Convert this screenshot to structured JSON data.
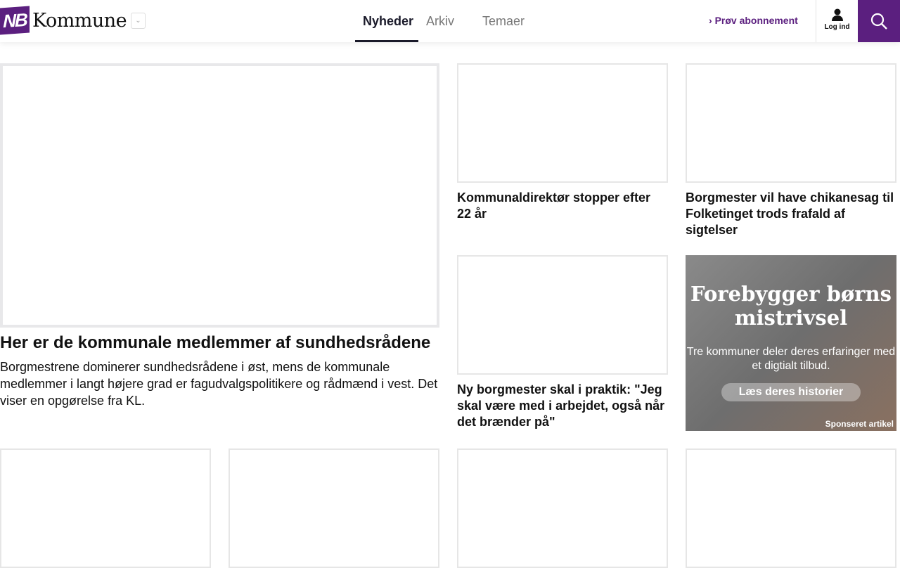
{
  "header": {
    "logo_mark": "NB",
    "logo_text": "Kommune",
    "nav": [
      "Nyheder",
      "Arkiv",
      "Temaer"
    ],
    "subscribe": "Prøv abonnement",
    "login": "Log ind",
    "accent": "#5b1f7f"
  },
  "main": {
    "headline": "Her er de kommunale medlemmer af sundhedsrådene",
    "lead": "Borgmestrene dominerer sundhedsrådene i øst, mens de kommunale medlemmer i langt højere grad er fagudvalgspolitikere og rådmænd i vest. Det viser en opgørelse fra KL."
  },
  "articles": [
    "Kommunaldirektør stopper efter 22 år",
    "Borgmester vil have chikanesag til Folketinget trods frafald af sigtelser",
    "Ny borgmester skal i praktik: \"Jeg skal være med i arbejdet, også når det brænder på\""
  ],
  "ad": {
    "title": "Forebygger børns mistrivsel",
    "subtitle": "Tre kommuner deler deres erfaringer med et digtialt tilbud.",
    "button": "Læs deres historier",
    "label": "Sponseret artikel"
  }
}
